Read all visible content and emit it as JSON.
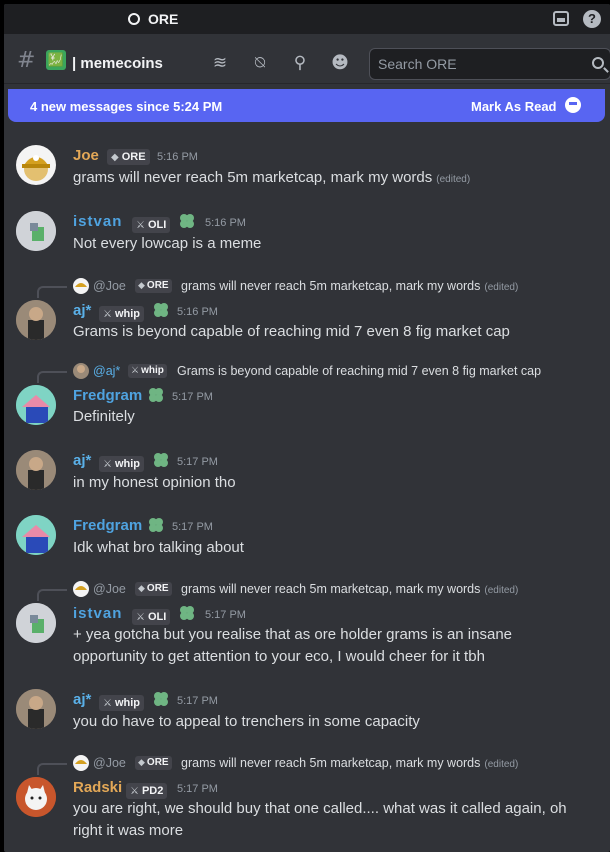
{
  "window": {
    "server_name": "ORE"
  },
  "channel": {
    "emoji": "💹",
    "name": "| memecoins"
  },
  "search": {
    "placeholder": "Search ORE"
  },
  "banner": {
    "text": "4 new messages since 5:24 PM",
    "action": "Mark As Read"
  },
  "colors": {
    "accent": "#5865f2",
    "joe": "#e3a857",
    "istvan": "#4fa3e0",
    "aj": "#5ab0e8",
    "fredgram": "#4fa3e0",
    "radski": "#e3a857"
  },
  "messages": [
    {
      "user": "Joe",
      "tag": "ORE",
      "time": "5:16 PM",
      "text": "grams will never reach 5m marketcap, mark my words",
      "edited": "(edited)"
    },
    {
      "user": "istvan",
      "tag": "OLI",
      "time": "5:16 PM",
      "text": "Not every lowcap is a meme"
    },
    {
      "reply": {
        "name": "@Joe",
        "tag": "ORE",
        "text": "grams will never reach 5m marketcap, mark my words",
        "edited": "(edited)"
      },
      "user": "aj*",
      "tag": "whip",
      "time": "5:16 PM",
      "text": "Grams is beyond capable of reaching mid 7 even 8 fig market cap"
    },
    {
      "reply": {
        "name": "@aj*",
        "tag": "whip",
        "text": "Grams is beyond capable of reaching mid 7 even 8 fig market cap"
      },
      "user": "Fredgram",
      "time": "5:17 PM",
      "text": "Definitely"
    },
    {
      "user": "aj*",
      "tag": "whip",
      "time": "5:17 PM",
      "text": "in my honest opinion tho"
    },
    {
      "user": "Fredgram",
      "time": "5:17 PM",
      "text": "Idk what bro talking about"
    },
    {
      "reply": {
        "name": "@Joe",
        "tag": "ORE",
        "text": "grams will never reach 5m marketcap, mark my words",
        "edited": "(edited)"
      },
      "user": "istvan",
      "tag": "OLI",
      "time": "5:17 PM",
      "text": "+ yea gotcha but you realise that as ore holder grams is an insane",
      "text2": "opportunity to get attention to your eco, I would cheer for it tbh"
    },
    {
      "user": "aj*",
      "tag": "whip",
      "time": "5:17 PM",
      "text": "you do have to appeal to trenchers in some capacity"
    },
    {
      "reply": {
        "name": "@Joe",
        "tag": "ORE",
        "text": "grams will never reach 5m marketcap, mark my words",
        "edited": "(edited)"
      },
      "user": "Radski",
      "tag": "PD2",
      "time": "5:17 PM",
      "text": "you are right, we should buy that one called.... what was it called again, oh",
      "text2": "right it was more"
    }
  ]
}
